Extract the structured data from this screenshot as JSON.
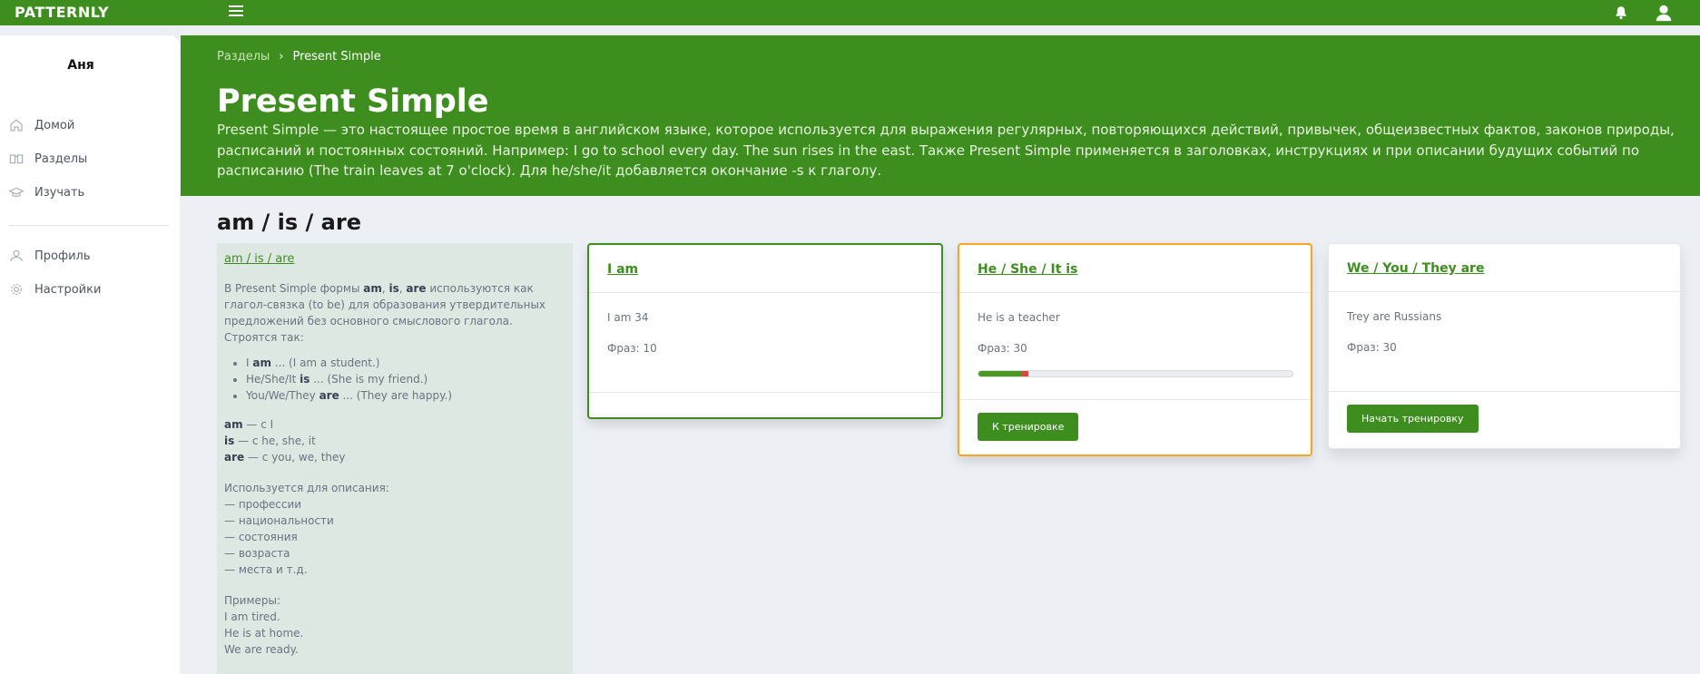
{
  "app": {
    "brand": "PATTERNLY"
  },
  "icons": {
    "menu": "menu-icon",
    "bell": "bell-icon",
    "user": "user-icon"
  },
  "colors": {
    "brand_green": "#3e8e1f",
    "active_border": "#f5a623",
    "error": "#e0443a",
    "page_bg": "#eceff4"
  },
  "sidebar": {
    "user_name": "Аня",
    "items": [
      {
        "label": "Домой",
        "icon": "home-icon"
      },
      {
        "label": "Разделы",
        "icon": "book-icon"
      },
      {
        "label": "Изучать",
        "icon": "graduation-cap-icon"
      },
      {
        "label": "Профиль",
        "icon": "user-icon"
      },
      {
        "label": "Настройки",
        "icon": "gear-icon"
      }
    ]
  },
  "hero": {
    "breadcrumb": {
      "parent": "Разделы",
      "current": "Present Simple"
    },
    "title": "Present Simple",
    "description": "Present Simple — это настоящее простое время в английском языке, которое используется для выражения регулярных, повторяющихся действий, привычек, общеизвестных фактов, законов природы, расписаний и постоянных состояний. Например: I go to school every day. The sun rises in the east. Также Present Simple применяется в заголовках, инструкциях и при описании будущих событий по расписанию (The train leaves at 7 o'clock). Для he/she/it добавляется окончание -s к глаголу."
  },
  "section": {
    "title": "am / is / are",
    "info": {
      "link": "am / is / are",
      "intro_1": "В Present Simple формы ",
      "intro_am": "am",
      "intro_comma1": ", ",
      "intro_is": "is",
      "intro_comma2": ", ",
      "intro_are": "are",
      "intro_2": " используются как глагол-связка (to be) для образования утвердительных предложений без основного смыслового глагола.",
      "built_label": "Строятся так:",
      "bullets": [
        {
          "pre": "I ",
          "bold": "am",
          "post": " ... (I am a student.)"
        },
        {
          "pre": "He/She/It ",
          "bold": "is",
          "post": " ... (She is my friend.)"
        },
        {
          "pre": "You/We/They ",
          "bold": "are",
          "post": " ... (They are happy.)"
        }
      ],
      "rules": [
        {
          "bold": "am",
          "post": " — с I"
        },
        {
          "bold": "is",
          "post": " — с he, she, it"
        },
        {
          "bold": "are",
          "post": " — с you, we, they"
        }
      ],
      "usage_label": "Используется для описания:",
      "usage": [
        "— профессии",
        "— национальности",
        "— состояния",
        "— возраста",
        "— места и т.д."
      ],
      "examples_label": "Примеры:",
      "examples": [
        "I am tired.",
        "He is at home.",
        "We are ready."
      ]
    },
    "cards": [
      {
        "title": "I am",
        "example": "I am 34",
        "count": "Фраз: 10"
      },
      {
        "title": "He / She / It is",
        "example": "He is a teacher",
        "count": "Фраз: 30",
        "progress": {
          "done_fraction": 0.135,
          "error_fraction": 0.025
        },
        "button": "К тренировке"
      },
      {
        "title": "We / You / They are",
        "example": "Trey are Russians",
        "count": "Фраз: 30",
        "button": "Начать тренировку"
      }
    ]
  }
}
